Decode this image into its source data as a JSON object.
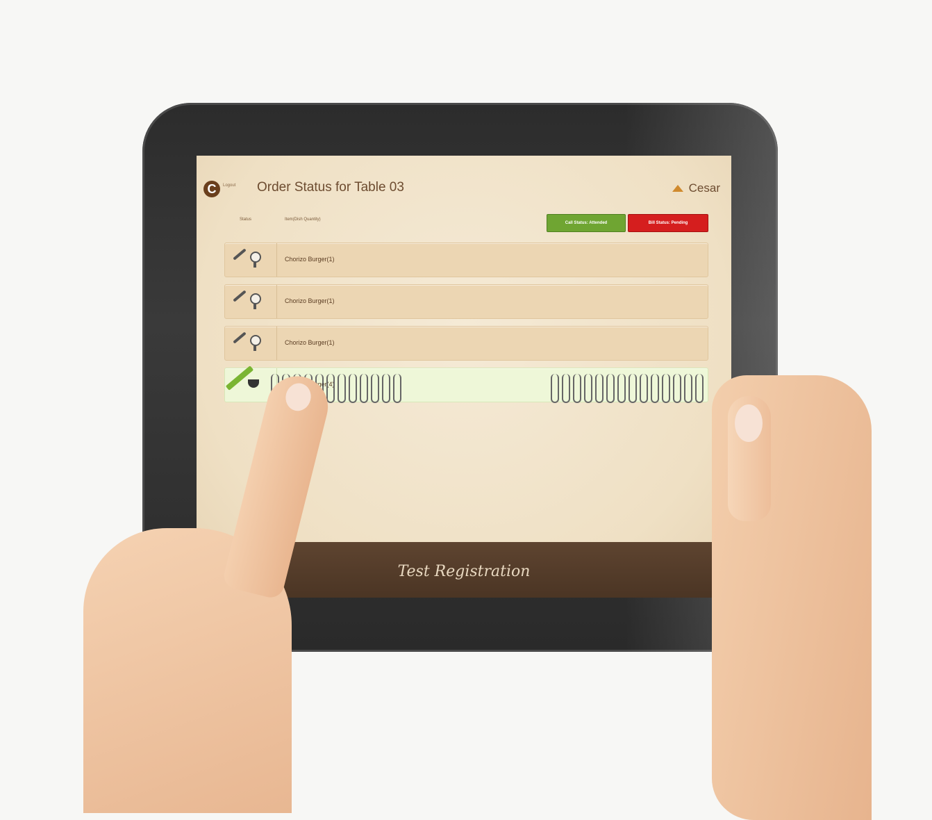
{
  "app": {
    "logo_letter": "C",
    "logout_label": "Logout",
    "title": "Order Status for Table 03",
    "user_name": "Cesar"
  },
  "columns": {
    "status": "Status",
    "item": "Item(Dish Quantity)"
  },
  "buttons": {
    "call_status": "Call Status: Attended",
    "bill_status": "Bill Status: Pending"
  },
  "orders": [
    {
      "label": "Chorizo Burger(1)",
      "state": "in-progress"
    },
    {
      "label": "Chorizo Burger(1)",
      "state": "in-progress"
    },
    {
      "label": "Chorizo Burger(1)",
      "state": "in-progress"
    },
    {
      "label": "Chorizo Burger(4)",
      "state": "served"
    }
  ],
  "footer": {
    "title": "Test Registration"
  },
  "colors": {
    "accent_green": "#6fa532",
    "accent_red": "#d51e1e",
    "brand_brown": "#6a3f1d"
  }
}
